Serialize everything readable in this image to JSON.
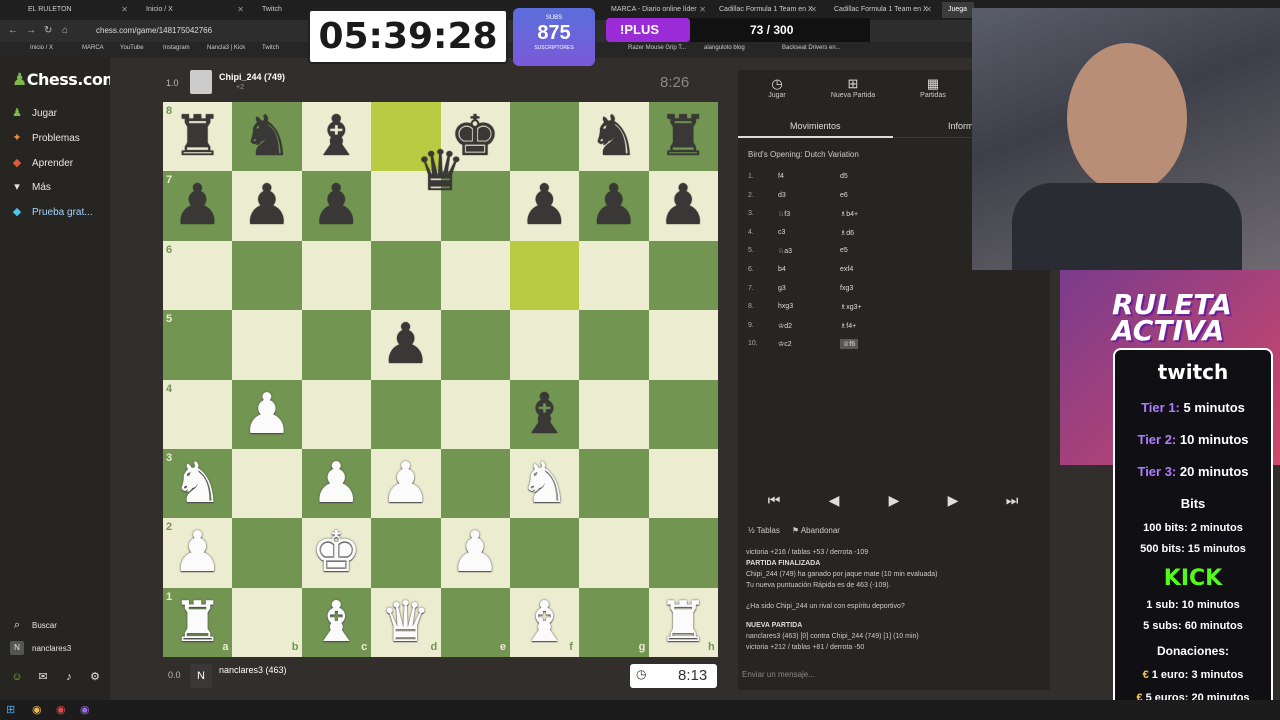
{
  "browser": {
    "tabs": [
      {
        "label": "EL RULETON"
      },
      {
        "label": "Inicio / X"
      },
      {
        "label": "Twitch"
      },
      {
        "label": "MARCA - Diario online líder"
      },
      {
        "label": "Cadillac Formula 1 Team en X"
      },
      {
        "label": "Cadillac Formula 1 Team en X"
      },
      {
        "label": "Juega"
      }
    ],
    "url": "chess.com/game/148175042766",
    "bookmarks": [
      "Inicio / X",
      "MARCA",
      "YouTube",
      "Instagram",
      "Nancla3 | Kick",
      "Twitch",
      "Razer Mouse Grip T...",
      "alanguloto blog",
      "Backseat Drivers en..."
    ]
  },
  "overlay": {
    "timer": "05:39:28",
    "subs_label": "SUBS",
    "subs_count": "875",
    "subs_sublabel": "SUSCRIPTORES",
    "plus": "!PLUS",
    "counter": "73 / 300",
    "ruleta_line1": "RULETA",
    "ruleta_line2": "ACTIVA"
  },
  "sidebar": {
    "logo": "Chess.com",
    "items": [
      {
        "label": "Jugar",
        "icon": "pawn-icon"
      },
      {
        "label": "Problemas",
        "icon": "puzzle-icon"
      },
      {
        "label": "Aprender",
        "icon": "learn-icon"
      },
      {
        "label": "Más",
        "icon": "chevron-down-icon"
      },
      {
        "label": "Prueba grat...",
        "icon": "diamond-icon"
      }
    ],
    "search": "Buscar",
    "username": "nanclares3"
  },
  "game": {
    "top_player": {
      "score": "1.0",
      "name": "Chipi_244 (749)",
      "clock": "8:26",
      "extra": "+2"
    },
    "bottom_player": {
      "score": "0.0",
      "initial": "N",
      "name": "nanclares3 (463)",
      "clock": "8:13"
    },
    "ranks": [
      "8",
      "7",
      "6",
      "5",
      "4",
      "3",
      "2",
      "1"
    ],
    "files": [
      "a",
      "b",
      "c",
      "d",
      "e",
      "f",
      "g",
      "h"
    ]
  },
  "panel": {
    "tabs": [
      {
        "label": "Jugar",
        "icon": "stopwatch-icon"
      },
      {
        "label": "Nueva Partida",
        "icon": "plus-icon"
      },
      {
        "label": "Partidas",
        "icon": "board-icon"
      }
    ],
    "move_tabs": [
      "Movimientos",
      "Inform"
    ],
    "opening": "Bird's Opening: Dutch Variation",
    "moves": [
      {
        "n": "1.",
        "w": "f4",
        "b": "d5"
      },
      {
        "n": "2.",
        "w": "d3",
        "b": "e6"
      },
      {
        "n": "3.",
        "w": "♘f3",
        "b": "♗b4+"
      },
      {
        "n": "4.",
        "w": "c3",
        "b": "♗d6"
      },
      {
        "n": "5.",
        "w": "♘a3",
        "b": "e5"
      },
      {
        "n": "6.",
        "w": "b4",
        "b": "exf4"
      },
      {
        "n": "7.",
        "w": "g3",
        "b": "fxg3"
      },
      {
        "n": "8.",
        "w": "hxg3",
        "b": "♗xg3+"
      },
      {
        "n": "9.",
        "w": "♔d2",
        "b": "♗f4+"
      },
      {
        "n": "10.",
        "w": "♔c2",
        "b": "♕f6"
      }
    ],
    "actions": [
      "Tablas",
      "Abandonar"
    ],
    "chat": [
      {
        "h": "",
        "t": "victoria +216 / tablas +53 / derrota -109"
      },
      {
        "h": "PARTIDA FINALIZADA",
        "t": ""
      },
      {
        "h": "",
        "t": "Chipi_244 (749) ha ganado por jaque mate (10 min evaluada)"
      },
      {
        "h": "",
        "t": "Tu nueva puntuación Rápida es de 463 (-109)."
      },
      {
        "h": "",
        "t": "¿Ha sido Chipi_244 un rival con espíritu deportivo?"
      },
      {
        "h": "NUEVA PARTIDA",
        "t": ""
      },
      {
        "h": "",
        "t": "nanclares3 (463) [0] contra Chipi_244 (749) [1] (10 min)"
      },
      {
        "h": "",
        "t": "victoria +212 / tablas +81 / derrota -50"
      }
    ],
    "chat_placeholder": "Enviar un mensaje..."
  },
  "card": {
    "brand": "twitch",
    "tier1": "Tier 1:",
    "tier1_val": "5 minutos",
    "tier2": "Tier 2:",
    "tier2_val": "10 minutos",
    "tier3": "Tier 3:",
    "tier3_val": "20 minutos",
    "bits": "Bits",
    "bits1": "100 bits: 2 minutos",
    "bits2": "500 bits: 15 minutos",
    "kick": "KICK",
    "kick1": "1 sub: 10 minutos",
    "kick2": "5 subs: 60 minutos",
    "don": "Donaciones:",
    "don1": "1 euro: 3 minutos",
    "don2": "5 euros: 20 minutos"
  }
}
